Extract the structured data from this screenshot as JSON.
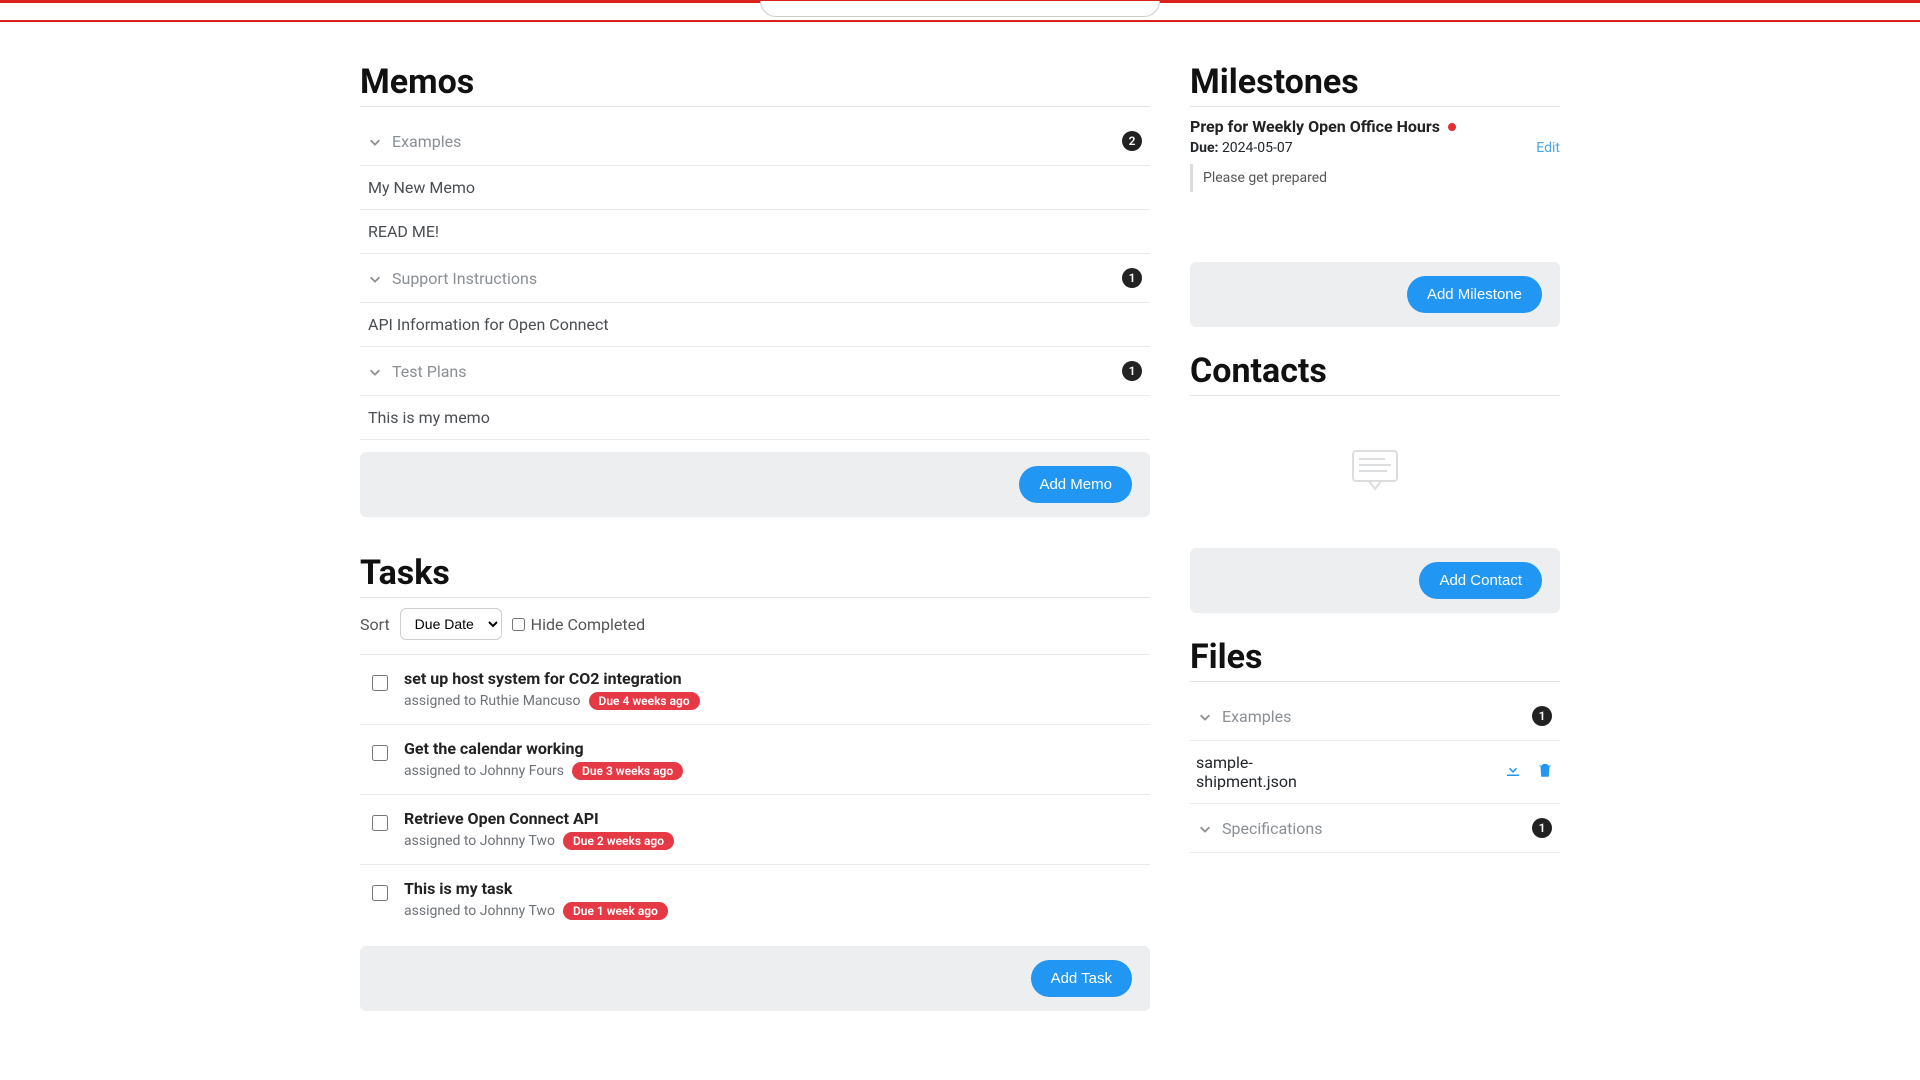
{
  "memos": {
    "title": "Memos",
    "groups": [
      {
        "name": "Examples",
        "count": "2",
        "items": [
          "My New Memo",
          "READ ME!"
        ]
      },
      {
        "name": "Support Instructions",
        "count": "1",
        "items": [
          "API Information for Open Connect"
        ]
      },
      {
        "name": "Test Plans",
        "count": "1",
        "items": [
          "This is my memo"
        ]
      }
    ],
    "add_label": "Add Memo"
  },
  "tasks": {
    "title": "Tasks",
    "sort_label": "Sort",
    "sort_value": "Due Date",
    "hide_completed_label": "Hide Completed",
    "items": [
      {
        "title": "set up host system for CO2 integration",
        "assigned": "assigned to Ruthie Mancuso",
        "due": "Due 4 weeks ago"
      },
      {
        "title": "Get the calendar working",
        "assigned": "assigned to Johnny Fours",
        "due": "Due 3 weeks ago"
      },
      {
        "title": "Retrieve Open Connect API",
        "assigned": "assigned to Johnny Two",
        "due": "Due 2 weeks ago"
      },
      {
        "title": "This is my task",
        "assigned": "assigned to Johnny Two",
        "due": "Due 1 week ago"
      }
    ],
    "add_label": "Add Task"
  },
  "milestones": {
    "title": "Milestones",
    "item": {
      "title": "Prep for Weekly Open Office Hours",
      "due_label": "Due:",
      "due_value": "2024-05-07",
      "note": "Please get prepared",
      "edit_label": "Edit"
    },
    "add_label": "Add Milestone"
  },
  "contacts": {
    "title": "Contacts",
    "add_label": "Add Contact"
  },
  "files": {
    "title": "Files",
    "groups": [
      {
        "name": "Examples",
        "count": "1",
        "items": [
          {
            "name": "sample-shipment.json"
          }
        ]
      },
      {
        "name": "Specifications",
        "count": "1",
        "items": []
      }
    ]
  }
}
